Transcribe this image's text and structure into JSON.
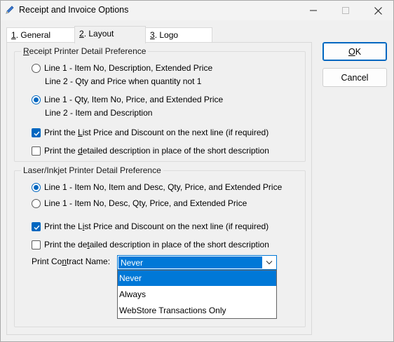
{
  "window": {
    "title": "Receipt and Invoice Options",
    "title_icon": "pencil-icon",
    "controls": [
      "minimize-icon",
      "maximize-icon",
      "close-icon"
    ]
  },
  "tabs": [
    {
      "key": "1",
      "label": ". General",
      "active": false
    },
    {
      "key": "2",
      "label": ". Layout",
      "active": true
    },
    {
      "key": "3",
      "label": ". Logo",
      "active": false
    }
  ],
  "receipt_group": {
    "title_u": "R",
    "title_rest": "eceipt Printer Detail Preference",
    "option1_line1": "Line 1 - Item No, Description, Extended Price",
    "option1_line2": "Line 2 - Qty and Price when quantity not 1",
    "option2_line1": "Line 1 - Qty, Item No, Price, and Extended Price",
    "option2_line2": "Line 2 - Item and Description",
    "selected_option": 2,
    "check1_pre": "Print the ",
    "check1_u": "L",
    "check1_post": "ist Price and Discount on the next line (if required)",
    "check1_checked": true,
    "check2_pre": "Print the ",
    "check2_u": "d",
    "check2_post": "etailed description in place of the short description",
    "check2_checked": false
  },
  "laser_group": {
    "title": "Laser/Inkjet Printer Detail Preference",
    "option1": "Line 1 - Item No, Item and Desc, Qty, Price, and Extended Price",
    "option2": "Line 1 - Item No, Desc, Qty, Price, and Extended Price",
    "selected_option": 1,
    "check1_pre": "Print the L",
    "check1_u": "i",
    "check1_post": "st Price and Discount on the next line (if required)",
    "check1_checked": true,
    "check2_pre": "Print the de",
    "check2_u": "t",
    "check2_post": "ailed description in place of the short description",
    "check2_checked": false,
    "contract_label_pre": "Print Co",
    "contract_label_u": "n",
    "contract_label_post": "tract Name:",
    "contract_value": "Never",
    "contract_options": [
      "Never",
      "Always",
      "WebStore Transactions Only"
    ],
    "contract_highlighted": "Never"
  },
  "buttons": {
    "ok_u": "O",
    "ok_rest": "K",
    "cancel": "Cancel"
  },
  "colors": {
    "accent": "#0067c0",
    "selection": "#0078d7"
  }
}
